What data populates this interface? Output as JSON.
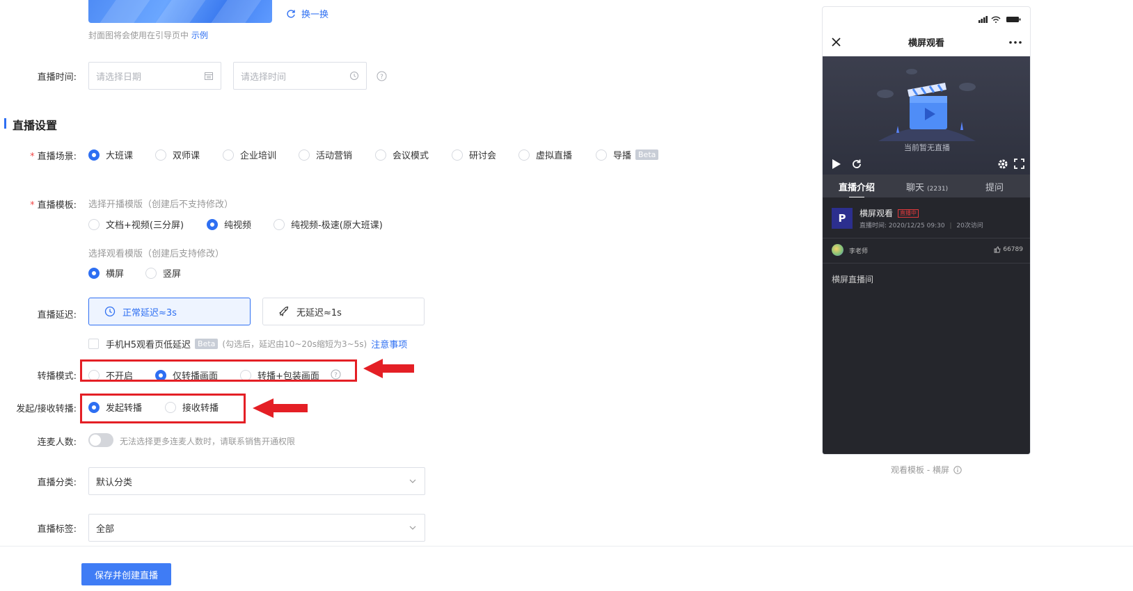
{
  "cover": {
    "change_label": "换一换",
    "hint": "封面图将会使用在引导页中",
    "hint_link": "示例"
  },
  "live_time": {
    "label": "直播时间:",
    "date_placeholder": "请选择日期",
    "time_placeholder": "请选择时间"
  },
  "section_title": "直播设置",
  "scene": {
    "label": "直播场景:",
    "options": [
      "大班课",
      "双师课",
      "企业培训",
      "活动营销",
      "会议模式",
      "研讨会",
      "虚拟直播",
      "导播"
    ],
    "selected": "大班课",
    "beta": "Beta"
  },
  "template": {
    "label": "直播模板:",
    "play_hint": "选择开播模版（创建后不支持修改）",
    "play_options": [
      "文档+视频(三分屏)",
      "纯视频",
      "纯视频-极速(原大班课)"
    ],
    "play_selected": "纯视频",
    "view_hint": "选择观看模版（创建后支持修改）",
    "view_options": [
      "横屏",
      "竖屏"
    ],
    "view_selected": "横屏"
  },
  "delay": {
    "label": "直播延迟:",
    "normal": "正常延迟≈3s",
    "none": "无延迟≈1s",
    "h5_label": "手机H5观看页低延迟",
    "h5_beta": "Beta",
    "h5_note": "(勾选后，延迟由10~20s缩短为3~5s)",
    "h5_link": "注意事项"
  },
  "relay_mode": {
    "label": "转播模式:",
    "options": [
      "不开启",
      "仅转播画面",
      "转播+包装画面"
    ],
    "selected": "仅转播画面"
  },
  "relay_role": {
    "label": "发起/接收转播:",
    "options": [
      "发起转播",
      "接收转播"
    ],
    "selected": "发起转播"
  },
  "mic": {
    "label": "连麦人数:",
    "hint": "无法选择更多连麦人数时，请联系销售开通权限"
  },
  "category": {
    "label": "直播分类:",
    "value": "默认分类"
  },
  "tag": {
    "label": "直播标签:",
    "value": "全部"
  },
  "submit_label": "保存并创建直播",
  "preview": {
    "nav_title": "横屏观看",
    "no_live": "当前暂无直播",
    "tabs": [
      "直播介绍",
      "聊天",
      "提问"
    ],
    "chat_count": "(2231)",
    "room_logo": "P",
    "room_title": "横屏观看",
    "live_badge": "直播中",
    "live_time": "直播时间: 2020/12/25 09:30",
    "visits": "20次访问",
    "teacher": "李老师",
    "likes": "66789",
    "room_desc": "横屏直播间",
    "caption": "观看模板 - 横屏"
  },
  "colors": {
    "primary": "#2e6ff2",
    "highlight": "#e41f25"
  }
}
